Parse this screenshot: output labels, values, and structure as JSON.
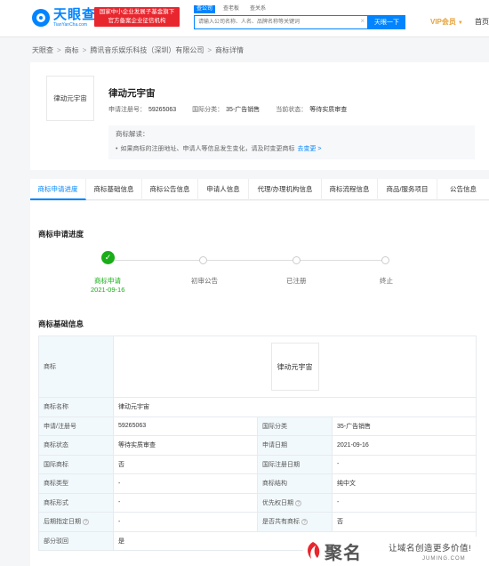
{
  "header": {
    "logo_cn": "天眼查",
    "logo_en": "TianYanCha.com",
    "promo_line1": "国家中小企业发展子基金旗下",
    "promo_line2": "官方备案企业征信机构",
    "search_tabs": [
      "查公司",
      "查老板",
      "查关系"
    ],
    "search_placeholder": "请输入公司名称、人名、品牌名称等关键词",
    "search_button": "天眼一下",
    "vip_label": "VIP会员",
    "home_link": "首页"
  },
  "breadcrumb": [
    "天眼查",
    "商标",
    "腾讯音乐娱乐科技（深圳）有限公司",
    "商标详情"
  ],
  "trademark": {
    "image_text": "律动元宇宙",
    "name": "律动元宇宙",
    "reg_no_label": "申请注册号：",
    "reg_no": "59265063",
    "class_label": "国际分类：",
    "class_value": "35-广告销售",
    "status_label": "当前状态：",
    "status_value": "等待实质审查",
    "explain_title": "商标解读：",
    "explain_text": "如果商标的注册地址、申请人等信息发生变化，请及时变更商标",
    "explain_link": "去变更 >"
  },
  "tabs": [
    "商标申请进度",
    "商标基础信息",
    "商标公告信息",
    "申请人信息",
    "代理/办理机构信息",
    "商标流程信息",
    "商品/服务项目",
    "公告信息"
  ],
  "progress": {
    "title": "商标申请进度",
    "steps": [
      {
        "label": "商标申请",
        "date": "2021-09-16",
        "done": true
      },
      {
        "label": "初审公告",
        "date": "",
        "done": false
      },
      {
        "label": "已注册",
        "date": "",
        "done": false
      },
      {
        "label": "终止",
        "date": "",
        "done": false
      }
    ]
  },
  "basic": {
    "title": "商标基础信息",
    "image_label": "商标",
    "image_text": "律动元宇宙",
    "name_label": "商标名称",
    "name_value": "律动元宇宙",
    "rows": [
      {
        "k1": "申请/注册号",
        "v1": "59265063",
        "k2": "国际分类",
        "v2": "35-广告销售"
      },
      {
        "k1": "商标状态",
        "v1": "等待实质审查",
        "k2": "申请日期",
        "v2": "2021-09-16"
      },
      {
        "k1": "国际商标",
        "v1": "否",
        "k2": "国际注册日期",
        "v2": "-"
      },
      {
        "k1": "商标类型",
        "v1": "-",
        "k2": "商标结构",
        "v2": "纯中文"
      },
      {
        "k1": "商标形式",
        "v1": "-",
        "k2": "优先权日期",
        "v2": "-"
      },
      {
        "k1": "后期指定日期",
        "v1": "-",
        "k2": "是否共有商标",
        "v2": "否"
      }
    ],
    "partial_label": "部分驳回",
    "partial_value": "是"
  },
  "watermark": {
    "logo": "聚名",
    "slogan": "让域名创造更多价值!",
    "url": "JUMING.COM"
  },
  "colors": {
    "brand_blue": "#0084ff",
    "promo_red": "#e8262e",
    "success_green": "#1aad19",
    "vip_gold": "#e8a33b"
  }
}
